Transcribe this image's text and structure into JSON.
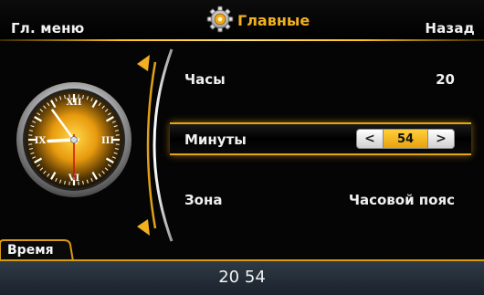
{
  "header": {
    "left_button": "Гл. меню",
    "title": "Главные",
    "right_button": "Назад"
  },
  "rows": {
    "hours": {
      "label": "Часы",
      "value": "20"
    },
    "minutes": {
      "label": "Минуты",
      "value": "54",
      "decrement": "<",
      "increment": ">"
    },
    "zone": {
      "label": "Зона",
      "value": "Часовой пояс"
    }
  },
  "clock": {
    "numerals": [
      "XII",
      "III",
      "VI",
      "IX"
    ],
    "hours": 20,
    "minutes": 54
  },
  "tab": {
    "label": "Время"
  },
  "footer": {
    "time": "20 54"
  },
  "colors": {
    "accent": "#f0b020",
    "highlight": "#e6a614",
    "footer": "#27313c"
  }
}
